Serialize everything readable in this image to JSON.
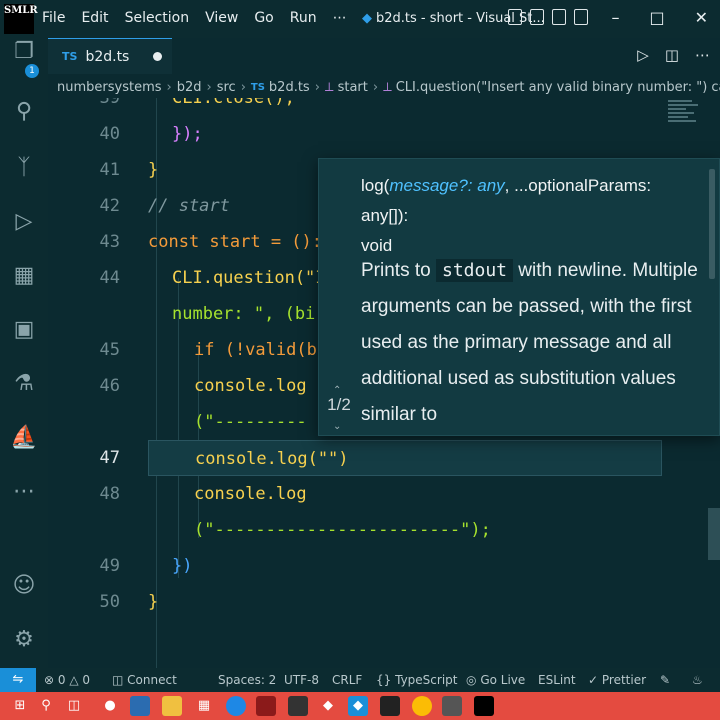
{
  "titlebar": {
    "logo_text": "SMLR",
    "menu": [
      "File",
      "Edit",
      "Selection",
      "View",
      "Go",
      "Run",
      "⋯"
    ],
    "window_title": "b2d.ts - short - Visual St...",
    "controls": [
      "–",
      "□",
      "✕"
    ]
  },
  "activity": {
    "items": [
      "files-icon",
      "search-icon",
      "source-control-icon",
      "run-debug-icon",
      "extensions-icon",
      "remote-explorer-icon",
      "testing-icon",
      "docker-icon",
      "more-icon",
      "account-icon",
      "settings-icon"
    ],
    "badge": "1"
  },
  "tab": {
    "lang": "TS",
    "name": "b2d.ts"
  },
  "breadcrumb": {
    "parts": [
      "numbersystems",
      "b2d",
      "src"
    ],
    "file_lang": "TS",
    "file": "b2d.ts",
    "symbol1": "start",
    "symbol2": "CLI.question(\"Insert any valid binary number: \") callback"
  },
  "editor": {
    "lines": [
      {
        "n": "39",
        "t": "CLI.close();"
      },
      {
        "n": "40",
        "t": "});"
      },
      {
        "n": "41",
        "t": "}"
      },
      {
        "n": "42",
        "t": "// start"
      },
      {
        "n": "43",
        "t": "const start = ():"
      },
      {
        "n": "44",
        "t": "CLI.question(\"I"
      },
      {
        "n": "",
        "t": "number: \", (bi"
      },
      {
        "n": "45",
        "t": "if (!valid(bin"
      },
      {
        "n": "46",
        "t": "console.log"
      },
      {
        "n": "",
        "t": "(\"---------"
      },
      {
        "n": "47",
        "t": "console.log(\"\")"
      },
      {
        "n": "48",
        "t": "console.log"
      },
      {
        "n": "",
        "t": "(\"------------------------\");"
      },
      {
        "n": "49",
        "t": "})"
      },
      {
        "n": "50",
        "t": "}"
      }
    ]
  },
  "hover": {
    "sig_fn": "log(",
    "sig_p1": "message?: any",
    "sig_mid": ", ...optionalParams: any[]):",
    "sig_ret": "void",
    "desc_a": "Prints to ",
    "desc_code": "stdout",
    "desc_b": " with newline. Multiple arguments can be passed, with the first used as the primary message and all additional used as substitution values similar to",
    "pager": "1/2"
  },
  "status": {
    "errors": "0",
    "warnings": "0",
    "connect": "Connect",
    "spaces": "Spaces: 2",
    "encoding": "UTF-8",
    "eol": "CRLF",
    "language": "TypeScript",
    "golive": "Go Live",
    "eslint": "ESLint",
    "prettier": "Prettier"
  },
  "colors": {
    "accent": "#1a8fd8",
    "taskbar": "#e44b40",
    "background": "#0b2a30"
  }
}
